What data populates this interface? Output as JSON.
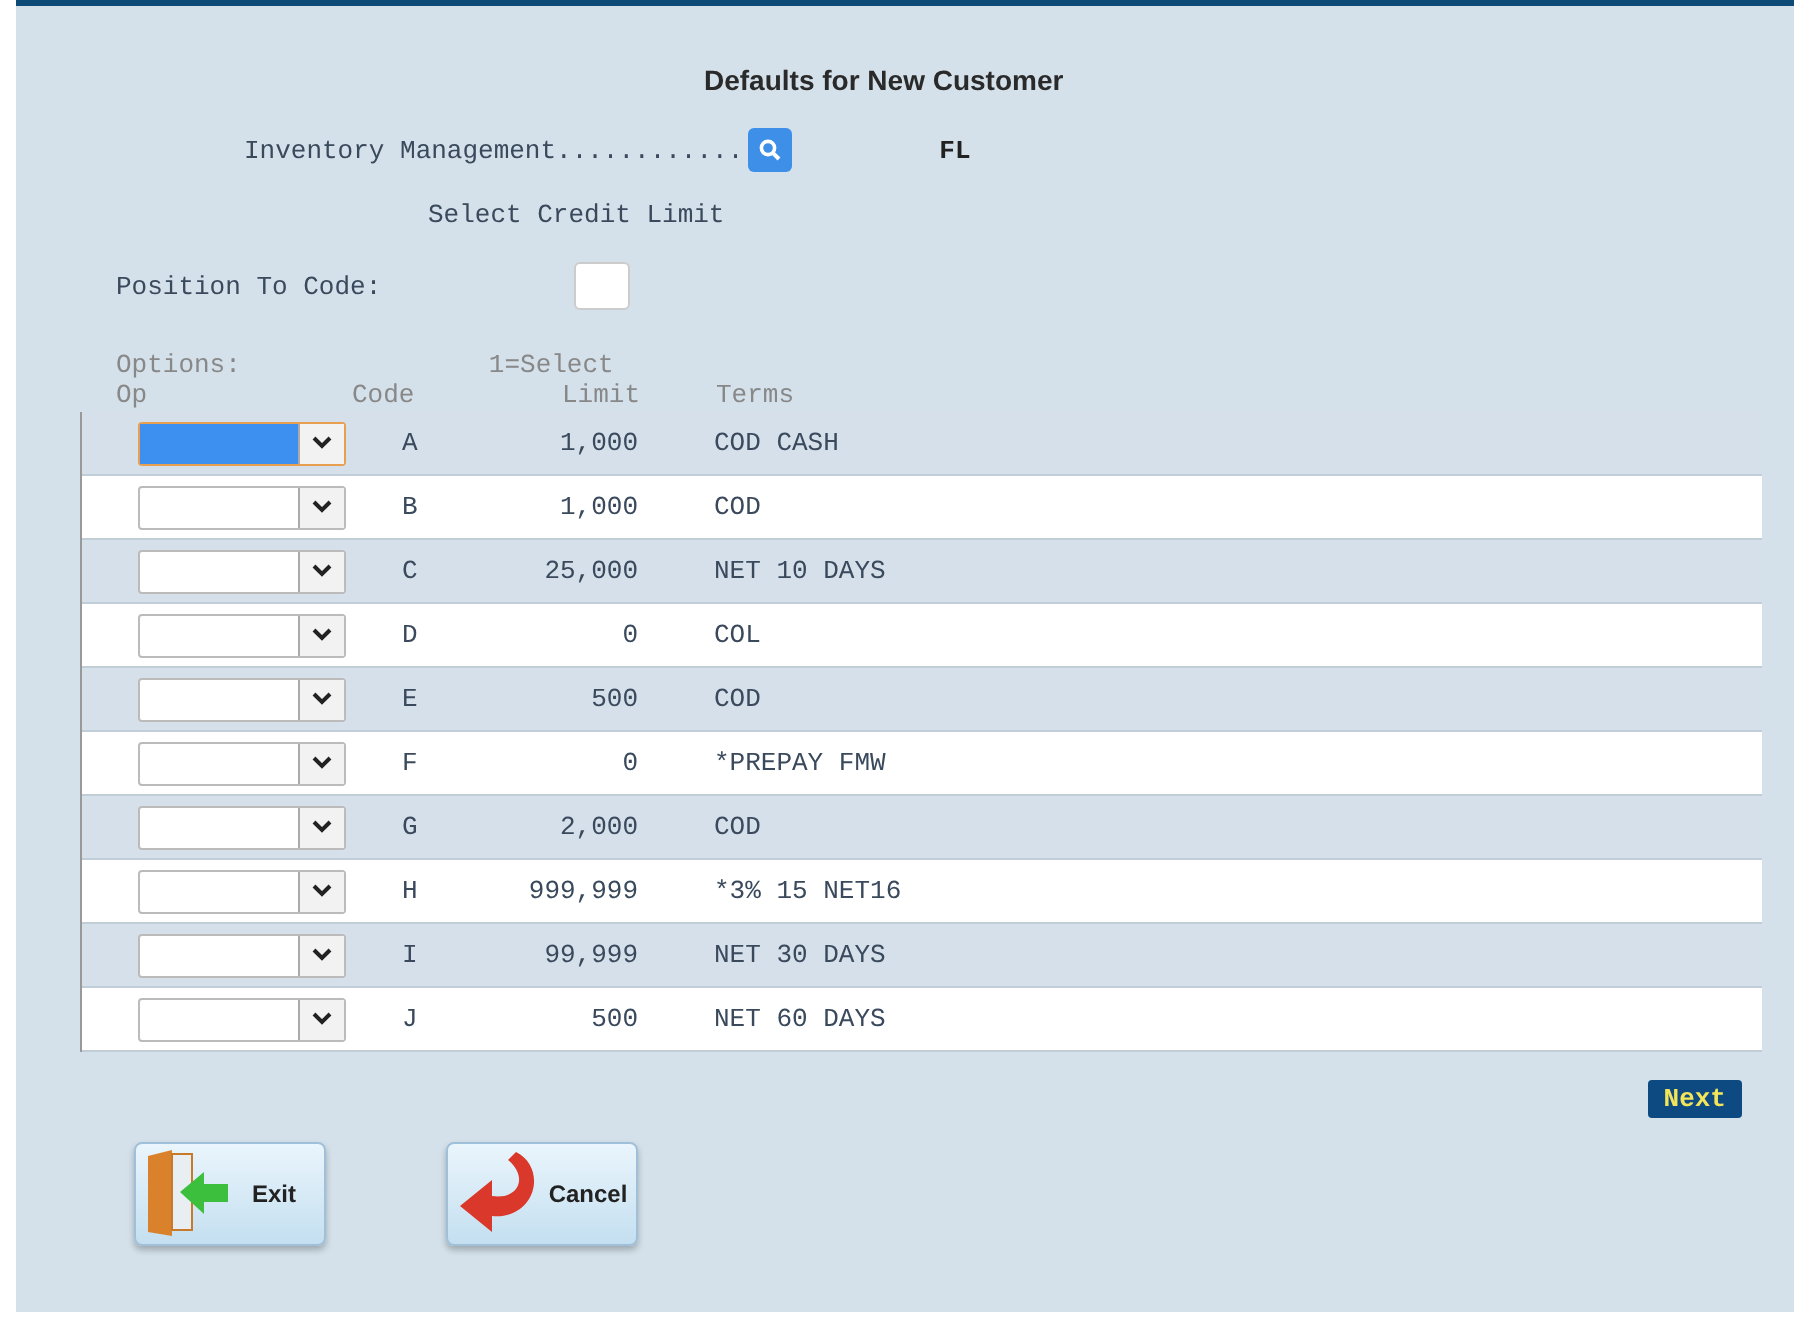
{
  "title": "Defaults for New Customer",
  "inventory": {
    "label": "Inventory Management............",
    "value": "FL"
  },
  "subtitle": "Select Credit Limit",
  "position": {
    "label": "Position To Code:"
  },
  "options": {
    "label": "Options:",
    "legend": "1=Select"
  },
  "table": {
    "columns": [
      "Op",
      "Code",
      "Limit",
      "Terms"
    ],
    "rows": [
      {
        "focused": true,
        "code": "A",
        "limit": "1,000",
        "terms": "COD CASH"
      },
      {
        "focused": false,
        "code": "B",
        "limit": "1,000",
        "terms": "COD"
      },
      {
        "focused": false,
        "code": "C",
        "limit": "25,000",
        "terms": "NET 10 DAYS"
      },
      {
        "focused": false,
        "code": "D",
        "limit": "0",
        "terms": "COL"
      },
      {
        "focused": false,
        "code": "E",
        "limit": "500",
        "terms": "COD"
      },
      {
        "focused": false,
        "code": "F",
        "limit": "0",
        "terms": "*PREPAY FMW"
      },
      {
        "focused": false,
        "code": "G",
        "limit": "2,000",
        "terms": "COD"
      },
      {
        "focused": false,
        "code": "H",
        "limit": "999,999",
        "terms": "*3% 15 NET16"
      },
      {
        "focused": false,
        "code": "I",
        "limit": "99,999",
        "terms": "NET 30 DAYS"
      },
      {
        "focused": false,
        "code": "J",
        "limit": "500",
        "terms": "NET 60 DAYS"
      }
    ]
  },
  "next": "Next",
  "buttons": [
    {
      "kind": "exit",
      "label": "Exit"
    },
    {
      "kind": "cancel",
      "label": "Cancel"
    }
  ]
}
